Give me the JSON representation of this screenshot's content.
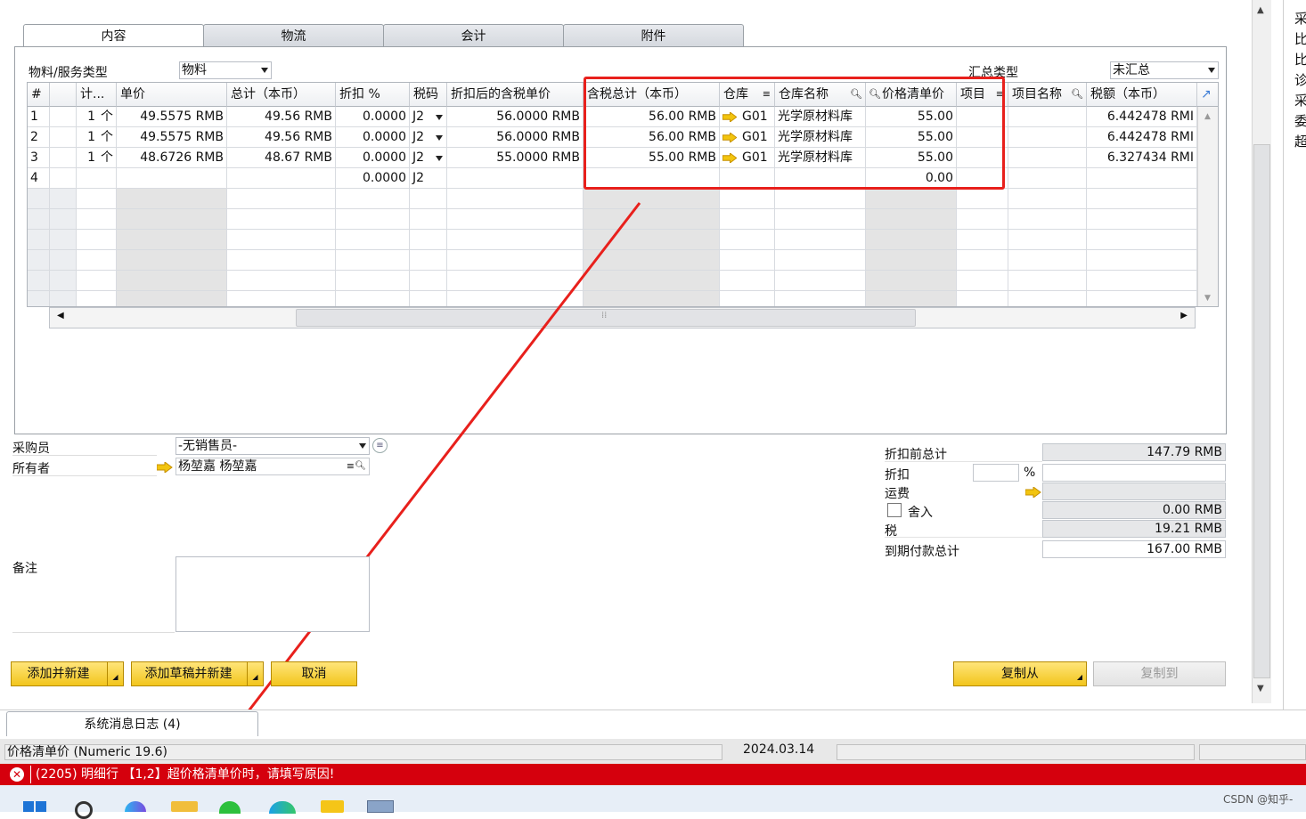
{
  "tabs": [
    "内容",
    "物流",
    "会计",
    "附件"
  ],
  "item_type_label": "物料/服务类型",
  "item_type_value": "物料",
  "summary_type_label": "汇总类型",
  "summary_type_value": "未汇总",
  "grid": {
    "headers": [
      "#",
      "计...",
      "单价",
      "总计（本币）",
      "折扣 %",
      "税码",
      "折扣后的含税单价",
      "含税总计（本币）",
      "仓库",
      "仓库名称",
      "价格清单价",
      "项目",
      "项目名称",
      "税额（本币）"
    ],
    "rows": [
      {
        "num": "1",
        "qty": "1",
        "unit": "个",
        "price": "49.5575 RMB",
        "total": "49.56 RMB",
        "disc": "0.0000",
        "tax": "J2",
        "disc_price": "56.0000 RMB",
        "gross": "56.00 RMB",
        "wh": "G01",
        "wh_name": "光学原材料库",
        "list_price": "55.00",
        "tax_amt": "6.442478 RMI"
      },
      {
        "num": "2",
        "qty": "1",
        "unit": "个",
        "price": "49.5575 RMB",
        "total": "49.56 RMB",
        "disc": "0.0000",
        "tax": "J2",
        "disc_price": "56.0000 RMB",
        "gross": "56.00 RMB",
        "wh": "G01",
        "wh_name": "光学原材料库",
        "list_price": "55.00",
        "tax_amt": "6.442478 RMI"
      },
      {
        "num": "3",
        "qty": "1",
        "unit": "个",
        "price": "48.6726 RMB",
        "total": "48.67 RMB",
        "disc": "0.0000",
        "tax": "J2",
        "disc_price": "55.0000 RMB",
        "gross": "55.00 RMB",
        "wh": "G01",
        "wh_name": "光学原材料库",
        "list_price": "55.00",
        "tax_amt": "6.327434 RMI"
      },
      {
        "num": "4",
        "qty": "",
        "unit": "",
        "price": "",
        "total": "",
        "disc": "0.0000",
        "tax": "J2",
        "disc_price": "",
        "gross": "",
        "wh": "",
        "wh_name": "",
        "list_price": "0.00",
        "tax_amt": ""
      }
    ]
  },
  "form": {
    "buyer_label": "采购员",
    "buyer_value": "-无销售员-",
    "owner_label": "所有者",
    "owner_value": "杨堃嘉 杨堃嘉",
    "remarks_label": "备注"
  },
  "totals": {
    "before_disc_label": "折扣前总计",
    "before_disc_value": "147.79 RMB",
    "disc_label": "折扣",
    "disc_pct": "%",
    "freight_label": "运费",
    "rounding_label": "舍入",
    "rounding_value": "0.00 RMB",
    "tax_label": "税",
    "tax_value": "19.21 RMB",
    "due_label": "到期付款总计",
    "due_value": "167.00 RMB"
  },
  "buttons": {
    "add_new": "添加并新建",
    "add_draft": "添加草稿并新建",
    "cancel": "取消",
    "copy_from": "复制从",
    "copy_to": "复制到"
  },
  "message_log_tab": "系统消息日志 (4)",
  "status": {
    "field_info": "价格清单价 (Numeric 19.6)",
    "date": "2024.03.14"
  },
  "error_message": "(2205) 明细行 【1,2】超价格清单价时，请填写原因!",
  "right_pane_chars": [
    "采",
    "比",
    "比",
    "诊",
    "采",
    "委",
    "超"
  ],
  "watermark": "CSDN @知乎-",
  "colors": {
    "error": "#d5000d",
    "highlight": "#e8201c",
    "button": "#f2c51c"
  }
}
